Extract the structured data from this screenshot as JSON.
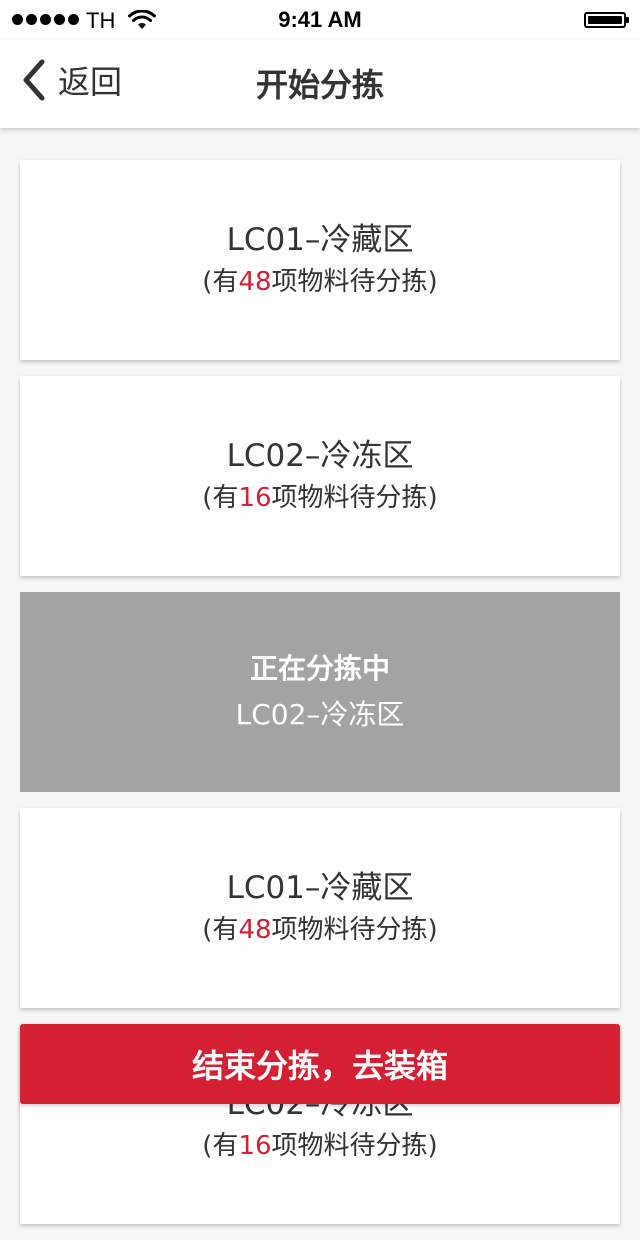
{
  "status_bar": {
    "carrier": "TH",
    "time": "9:41 AM",
    "battery_level": 1.0
  },
  "nav": {
    "back_label": "返回",
    "title": "开始分拣"
  },
  "zones": [
    {
      "name": "LC01–冷藏区",
      "prefix": "(有",
      "count": "48",
      "suffix": "项物料待分拣)"
    },
    {
      "name": "LC02–冷冻区",
      "prefix": "(有",
      "count": "16",
      "suffix": "项物料待分拣)"
    },
    {
      "status": "正在分拣中",
      "name": "LC02–冷冻区"
    },
    {
      "name": "LC01–冷藏区",
      "prefix": "(有",
      "count": "48",
      "suffix": "项物料待分拣)"
    },
    {
      "name": "LC02–冷冻区",
      "prefix": "(有",
      "count": "16",
      "suffix": "项物料待分拣)"
    }
  ],
  "finish_button": {
    "label": "结束分拣，去装箱"
  },
  "colors": {
    "accent": "#d51f33",
    "active_card": "#a3a3a3",
    "background": "#f6f6f6"
  }
}
